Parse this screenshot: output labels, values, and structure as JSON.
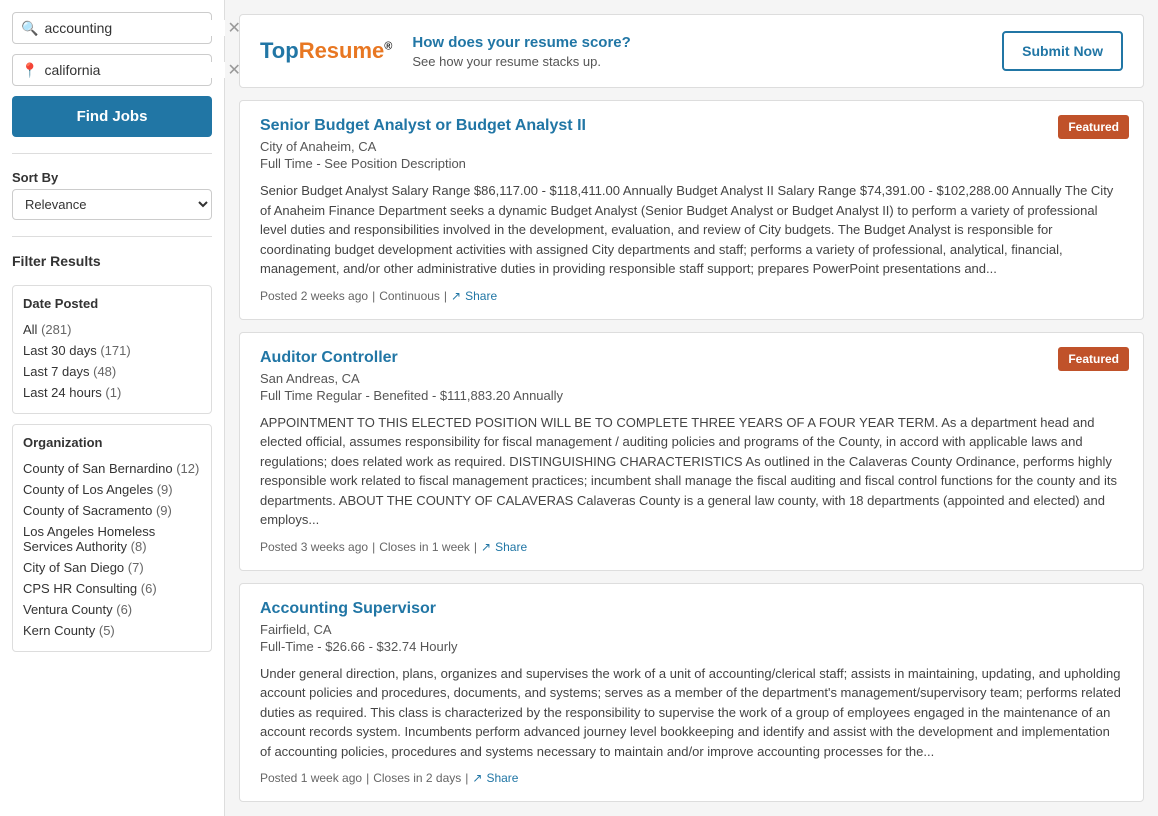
{
  "sidebar": {
    "search_placeholder": "accounting",
    "search_value": "accounting",
    "location_placeholder": "california",
    "location_value": "california",
    "find_jobs_label": "Find Jobs",
    "sort_by_label": "Sort By",
    "sort_options": [
      "Relevance"
    ],
    "sort_selected": "Relevance",
    "filter_results_label": "Filter Results",
    "date_posted_label": "Date Posted",
    "date_filters": [
      {
        "label": "All",
        "count": "(281)"
      },
      {
        "label": "Last 30 days",
        "count": "(171)"
      },
      {
        "label": "Last 7 days",
        "count": "(48)"
      },
      {
        "label": "Last 24 hours",
        "count": "(1)"
      }
    ],
    "organization_label": "Organization",
    "org_filters": [
      {
        "label": "County of San Bernardino",
        "count": "(12)"
      },
      {
        "label": "County of Los Angeles",
        "count": "(9)"
      },
      {
        "label": "County of Sacramento",
        "count": "(9)"
      },
      {
        "label": "Los Angeles Homeless Services Authority",
        "count": "(8)"
      },
      {
        "label": "City of San Diego",
        "count": "(7)"
      },
      {
        "label": "CPS HR Consulting",
        "count": "(6)"
      },
      {
        "label": "Ventura County",
        "count": "(6)"
      },
      {
        "label": "Kern County",
        "count": "(5)"
      }
    ]
  },
  "banner": {
    "logo_regular": "Top",
    "logo_accent": "Resume",
    "logo_symbol": "®",
    "headline": "How does your resume score?",
    "subtext": "See how your resume stacks up.",
    "button_label": "Submit Now"
  },
  "jobs": [
    {
      "title": "Senior Budget Analyst or Budget Analyst II",
      "location": "City of Anaheim, CA",
      "type": "Full Time - See Position Description",
      "featured": true,
      "featured_label": "Featured",
      "description": "Senior Budget Analyst Salary Range $86,117.00 - $118,411.00 Annually Budget Analyst II Salary Range $74,391.00 - $102,288.00 Annually The  City of Anaheim Finance Department  seeks a dynamic  Budget Analyst  (Senior Budget Analyst or Budget Analyst II) to perform a variety of professional level duties and responsibilities involved in the development, evaluation, and review of City budgets.  The Budget Analyst is responsible for coordinating budget development activities with assigned City departments and staff; performs a variety of professional, analytical, financial, management, and/or other administrative duties in providing responsible staff support; prepares PowerPoint presentations and...",
      "posted": "Posted 2 weeks ago",
      "continuous": "Continuous",
      "share_label": "Share"
    },
    {
      "title": "Auditor Controller",
      "location": "San Andreas, CA",
      "type": "Full Time Regular - Benefited - $111,883.20 Annually",
      "featured": true,
      "featured_label": "Featured",
      "description": "APPOINTMENT TO THIS ELECTED POSITION WILL BE TO COMPLETE THREE YEARS OF A FOUR YEAR TERM. As a department head and elected official, assumes responsibility for fiscal management / auditing policies and programs of the County, in accord with applicable laws and regulations; does related work as required. DISTINGUISHING CHARACTERISTICS  As outlined in the Calaveras County Ordinance, performs highly responsible work related to fiscal management practices; incumbent shall manage the fiscal auditing and fiscal control functions for the county and its departments. ABOUT THE COUNTY OF CALAVERAS Calaveras County is a general law county, with 18 departments (appointed and elected) and employs...",
      "posted": "Posted 3 weeks ago",
      "continuous": "Closes in 1 week",
      "share_label": "Share"
    },
    {
      "title": "Accounting Supervisor",
      "location": "Fairfield, CA",
      "type": "Full-Time - $26.66 - $32.74 Hourly",
      "featured": false,
      "featured_label": "",
      "description": "Under general direction, plans, organizes and supervises the work of a unit of accounting/clerical staff; assists in maintaining, updating, and upholding account policies and procedures, documents, and systems; serves as a member of the department's management/supervisory team; performs related duties as required. This class is characterized by the responsibility to supervise the work of a group of employees engaged in the maintenance of an account records system. Incumbents perform advanced journey level bookkeeping and identify and assist with the development and implementation of accounting policies, procedures and systems necessary to maintain and/or improve accounting processes for the...",
      "posted": "Posted 1 week ago",
      "continuous": "Closes in 2 days",
      "share_label": "Share"
    }
  ],
  "icons": {
    "search": "🔍",
    "location": "📍",
    "share": "↗",
    "clear": "✕"
  }
}
